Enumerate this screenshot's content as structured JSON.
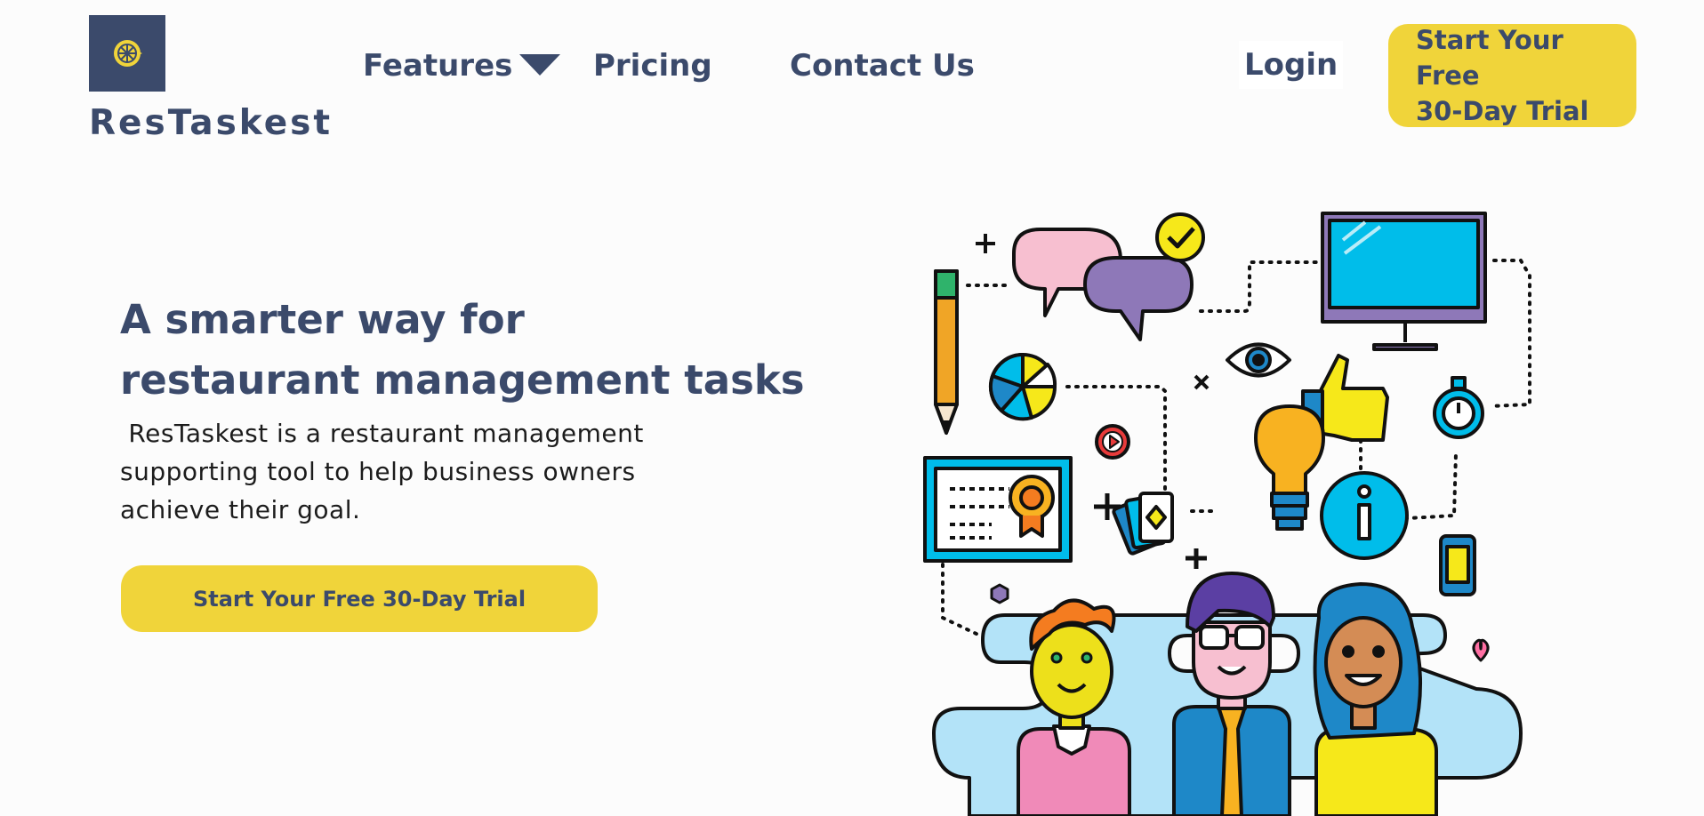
{
  "brand": {
    "name": "ResTaskest",
    "logo_icon": "lemon-slice-icon"
  },
  "nav": {
    "features_label": "Features",
    "pricing_label": "Pricing",
    "contact_label": "Contact Us",
    "login_label": "Login",
    "trial_line1": "Start Your Free",
    "trial_line2": "30-Day Trial"
  },
  "hero": {
    "title_line1": "A smarter way for",
    "title_line2": "restaurant management tasks",
    "desc_line1": " ResTaskest is a restaurant management",
    "desc_line2": "supporting tool to help business owners",
    "desc_line3": "achieve their goal.",
    "cta_label": "Start Your Free 30-Day Trial"
  },
  "colors": {
    "brand_navy": "#3b4a6b",
    "accent_yellow": "#f0d43a",
    "background": "#fcfcfc"
  }
}
